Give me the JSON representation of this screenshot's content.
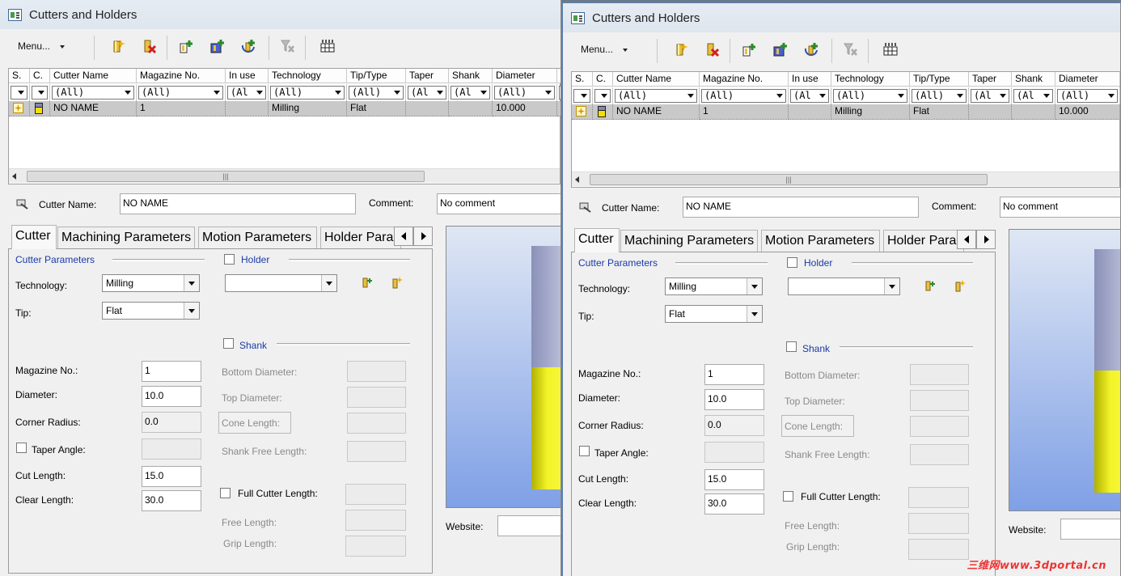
{
  "window": {
    "title": "Cutters and Holders"
  },
  "toolbar": {
    "menu_label": "Menu...",
    "buttons": [
      "new-cutter-icon",
      "delete-cutter-icon",
      "import-icon",
      "import-library-icon",
      "export-icon",
      "clear-filter-icon",
      "table-settings-icon"
    ]
  },
  "grid": {
    "columns": [
      "S.",
      "C.",
      "Cutter Name",
      "Magazine No.",
      "In use",
      "Technology",
      "Tip/Type",
      "Taper",
      "Shank",
      "Diameter"
    ],
    "filter_value": "(All)",
    "filter_short": "(Al",
    "row": {
      "name": "NO NAME",
      "magazine": "1",
      "in_use": "",
      "technology": "Milling",
      "tip": "Flat",
      "taper": "",
      "shank": "",
      "diameter": "10.000"
    }
  },
  "header_fields": {
    "cutter_name_label": "Cutter Name:",
    "cutter_name_value": "NO NAME",
    "comment_label": "Comment:",
    "comment_value": "No comment"
  },
  "tabs": [
    "Cutter",
    "Machining Parameters",
    "Motion Parameters",
    "Holder Para"
  ],
  "cutter": {
    "section_title": "Cutter Parameters",
    "technology_label": "Technology:",
    "technology_value": "Milling",
    "tip_label": "Tip:",
    "tip_value": "Flat",
    "magazine_label": "Magazine No.:",
    "magazine_value": "1",
    "diameter_label": "Diameter:",
    "diameter_value": "10.0",
    "corner_radius_label": "Corner Radius:",
    "corner_radius_value": "0.0",
    "taper_angle_label": "Taper Angle:",
    "cut_length_label": "Cut Length:",
    "cut_length_value": "15.0",
    "clear_length_label": "Clear Length:",
    "clear_length_value": "30.0"
  },
  "holder": {
    "title": "Holder"
  },
  "shank": {
    "title": "Shank",
    "bottom_diameter": "Bottom Diameter:",
    "top_diameter": "Top Diameter:",
    "cone_length": "Cone Length:",
    "shank_free_length": "Shank Free Length:"
  },
  "full_cutter": {
    "label": "Full Cutter Length:",
    "free_length": "Free Length:",
    "grip_length": "Grip Length:"
  },
  "website_label": "Website:",
  "watermark": "三维网www.3dportal.cn"
}
